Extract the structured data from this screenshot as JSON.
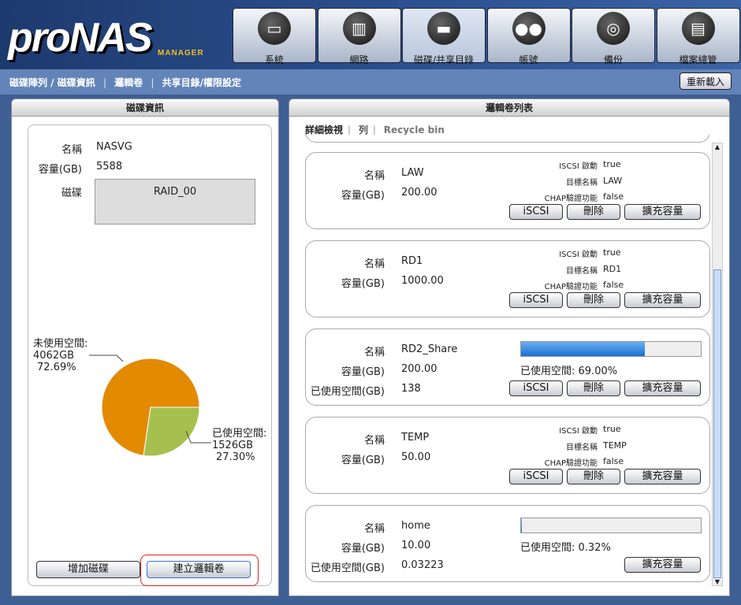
{
  "logo": {
    "text": "proNAS",
    "sub": "MANAGER"
  },
  "nav": [
    {
      "label": "系統",
      "icon": "computer-icon"
    },
    {
      "label": "網路",
      "icon": "network-icon"
    },
    {
      "label": "磁碟/共享目錄",
      "icon": "disk-icon"
    },
    {
      "label": "帳號",
      "icon": "users-icon"
    },
    {
      "label": "備份",
      "icon": "backup-icon"
    },
    {
      "label": "檔案總管",
      "icon": "file-manager-icon"
    }
  ],
  "subnav": {
    "items": [
      "磁碟陣列 / 磁碟資訊",
      "邏輯卷",
      "共享目錄/權限設定"
    ],
    "reload": "重新載入"
  },
  "left": {
    "title": "磁碟資訊",
    "name_label": "名稱",
    "name": "NASVG",
    "cap_label": "容量(GB)",
    "cap": "5588",
    "disk_label": "磁碟",
    "disk": "RAID_00",
    "free_label": "未使用空間:",
    "free_gb": "4062GB",
    "free_pct": "72.69%",
    "used_label": "已使用空間:",
    "used_gb": "1526GB",
    "used_pct": "27.30%",
    "add_disk": "增加磁碟",
    "create_volume": "建立邏輯卷"
  },
  "chart_data": {
    "type": "pie",
    "slices": [
      {
        "label": "未使用空間",
        "value": 72.69,
        "gb": 4062,
        "color": "#e38a00"
      },
      {
        "label": "已使用空間",
        "value": 27.3,
        "gb": 1526,
        "color": "#a6c050"
      }
    ]
  },
  "right": {
    "title": "邏輯卷列表",
    "tabs": [
      "詳細檢視",
      "列",
      "Recycle bin"
    ],
    "labels": {
      "name": "名稱",
      "cap": "容量(GB)",
      "used": "已使用空間(GB)",
      "iscsi_on": "ISCSI 啟動",
      "target": "目標名稱",
      "chap": "CHAP驗證功能",
      "used_pct": "已使用空間: "
    },
    "buttons": {
      "iscsi": "iSCSI",
      "delete": "刪除",
      "expand": "擴充容量"
    },
    "volumes": [
      {
        "name": "LAW",
        "cap": "200.00",
        "iscsi": "true",
        "target": "LAW",
        "chap": "false"
      },
      {
        "name": "RD1",
        "cap": "1000.00",
        "iscsi": "true",
        "target": "RD1",
        "chap": "false"
      },
      {
        "name": "RD2_Share",
        "cap": "200.00",
        "used": "138",
        "used_pct": "69.00%",
        "fill": 69.0
      },
      {
        "name": "TEMP",
        "cap": "50.00",
        "iscsi": "true",
        "target": "TEMP",
        "chap": "false"
      },
      {
        "name": "home",
        "cap": "10.00",
        "used": "0.03223",
        "used_pct": "0.32%",
        "fill": 0.32
      }
    ]
  }
}
